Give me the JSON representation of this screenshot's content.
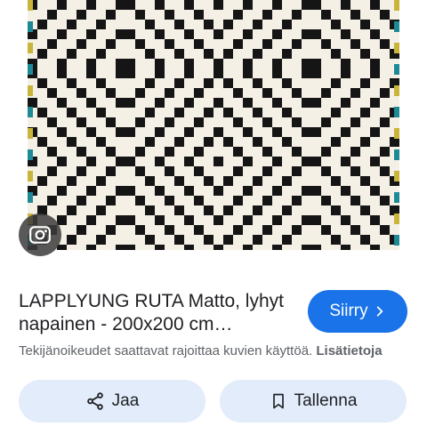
{
  "image": {
    "subject": "LAPPLYUNG RUTA rug",
    "pattern_colors": {
      "background": "#f5f0e6",
      "pattern": "#151515",
      "border_accent": [
        "#c9b53a",
        "#1e8a96"
      ]
    }
  },
  "result": {
    "title": "LAPPLYUNG RUTA Matto, lyhyt napainen - 200x200 cm…",
    "visit_label": "Siirry",
    "copyright_text": "Tekijänoikeudet saattavat rajoittaa kuvien käyttöä. ",
    "learn_more": "Lisätietoja"
  },
  "actions": {
    "share_label": "Jaa",
    "save_label": "Tallenna"
  },
  "icons": {
    "lens": "lens-icon",
    "visit": "chevron-right-icon",
    "share": "share-icon",
    "save": "bookmark-icon"
  },
  "colors": {
    "accent": "#1a73e8",
    "button_bg": "#e2ecfb",
    "text": "#202124",
    "muted": "#5f6368"
  }
}
